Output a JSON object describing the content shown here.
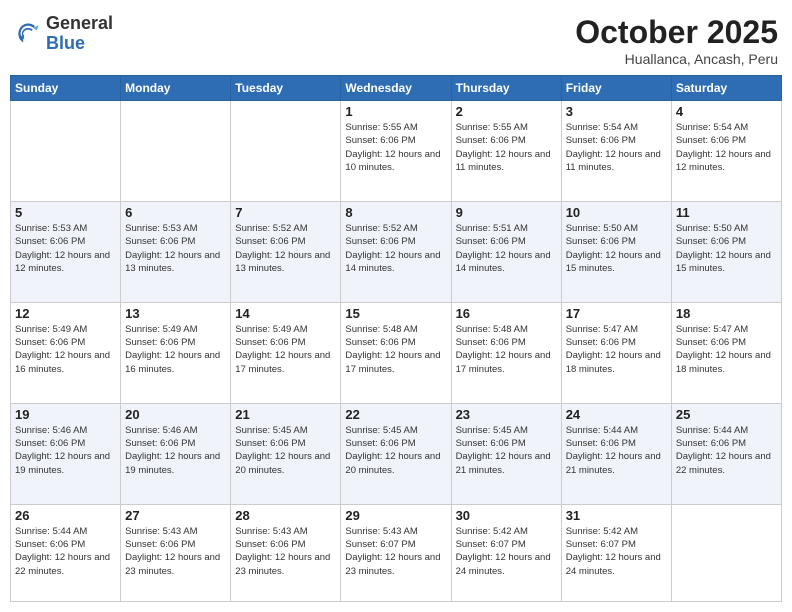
{
  "header": {
    "logo_general": "General",
    "logo_blue": "Blue",
    "month_title": "October 2025",
    "location": "Huallanca, Ancash, Peru"
  },
  "days_of_week": [
    "Sunday",
    "Monday",
    "Tuesday",
    "Wednesday",
    "Thursday",
    "Friday",
    "Saturday"
  ],
  "weeks": [
    [
      {
        "day": "",
        "info": ""
      },
      {
        "day": "",
        "info": ""
      },
      {
        "day": "",
        "info": ""
      },
      {
        "day": "1",
        "info": "Sunrise: 5:55 AM\nSunset: 6:06 PM\nDaylight: 12 hours\nand 10 minutes."
      },
      {
        "day": "2",
        "info": "Sunrise: 5:55 AM\nSunset: 6:06 PM\nDaylight: 12 hours\nand 11 minutes."
      },
      {
        "day": "3",
        "info": "Sunrise: 5:54 AM\nSunset: 6:06 PM\nDaylight: 12 hours\nand 11 minutes."
      },
      {
        "day": "4",
        "info": "Sunrise: 5:54 AM\nSunset: 6:06 PM\nDaylight: 12 hours\nand 12 minutes."
      }
    ],
    [
      {
        "day": "5",
        "info": "Sunrise: 5:53 AM\nSunset: 6:06 PM\nDaylight: 12 hours\nand 12 minutes."
      },
      {
        "day": "6",
        "info": "Sunrise: 5:53 AM\nSunset: 6:06 PM\nDaylight: 12 hours\nand 13 minutes."
      },
      {
        "day": "7",
        "info": "Sunrise: 5:52 AM\nSunset: 6:06 PM\nDaylight: 12 hours\nand 13 minutes."
      },
      {
        "day": "8",
        "info": "Sunrise: 5:52 AM\nSunset: 6:06 PM\nDaylight: 12 hours\nand 14 minutes."
      },
      {
        "day": "9",
        "info": "Sunrise: 5:51 AM\nSunset: 6:06 PM\nDaylight: 12 hours\nand 14 minutes."
      },
      {
        "day": "10",
        "info": "Sunrise: 5:50 AM\nSunset: 6:06 PM\nDaylight: 12 hours\nand 15 minutes."
      },
      {
        "day": "11",
        "info": "Sunrise: 5:50 AM\nSunset: 6:06 PM\nDaylight: 12 hours\nand 15 minutes."
      }
    ],
    [
      {
        "day": "12",
        "info": "Sunrise: 5:49 AM\nSunset: 6:06 PM\nDaylight: 12 hours\nand 16 minutes."
      },
      {
        "day": "13",
        "info": "Sunrise: 5:49 AM\nSunset: 6:06 PM\nDaylight: 12 hours\nand 16 minutes."
      },
      {
        "day": "14",
        "info": "Sunrise: 5:49 AM\nSunset: 6:06 PM\nDaylight: 12 hours\nand 17 minutes."
      },
      {
        "day": "15",
        "info": "Sunrise: 5:48 AM\nSunset: 6:06 PM\nDaylight: 12 hours\nand 17 minutes."
      },
      {
        "day": "16",
        "info": "Sunrise: 5:48 AM\nSunset: 6:06 PM\nDaylight: 12 hours\nand 17 minutes."
      },
      {
        "day": "17",
        "info": "Sunrise: 5:47 AM\nSunset: 6:06 PM\nDaylight: 12 hours\nand 18 minutes."
      },
      {
        "day": "18",
        "info": "Sunrise: 5:47 AM\nSunset: 6:06 PM\nDaylight: 12 hours\nand 18 minutes."
      }
    ],
    [
      {
        "day": "19",
        "info": "Sunrise: 5:46 AM\nSunset: 6:06 PM\nDaylight: 12 hours\nand 19 minutes."
      },
      {
        "day": "20",
        "info": "Sunrise: 5:46 AM\nSunset: 6:06 PM\nDaylight: 12 hours\nand 19 minutes."
      },
      {
        "day": "21",
        "info": "Sunrise: 5:45 AM\nSunset: 6:06 PM\nDaylight: 12 hours\nand 20 minutes."
      },
      {
        "day": "22",
        "info": "Sunrise: 5:45 AM\nSunset: 6:06 PM\nDaylight: 12 hours\nand 20 minutes."
      },
      {
        "day": "23",
        "info": "Sunrise: 5:45 AM\nSunset: 6:06 PM\nDaylight: 12 hours\nand 21 minutes."
      },
      {
        "day": "24",
        "info": "Sunrise: 5:44 AM\nSunset: 6:06 PM\nDaylight: 12 hours\nand 21 minutes."
      },
      {
        "day": "25",
        "info": "Sunrise: 5:44 AM\nSunset: 6:06 PM\nDaylight: 12 hours\nand 22 minutes."
      }
    ],
    [
      {
        "day": "26",
        "info": "Sunrise: 5:44 AM\nSunset: 6:06 PM\nDaylight: 12 hours\nand 22 minutes."
      },
      {
        "day": "27",
        "info": "Sunrise: 5:43 AM\nSunset: 6:06 PM\nDaylight: 12 hours\nand 23 minutes."
      },
      {
        "day": "28",
        "info": "Sunrise: 5:43 AM\nSunset: 6:06 PM\nDaylight: 12 hours\nand 23 minutes."
      },
      {
        "day": "29",
        "info": "Sunrise: 5:43 AM\nSunset: 6:07 PM\nDaylight: 12 hours\nand 23 minutes."
      },
      {
        "day": "30",
        "info": "Sunrise: 5:42 AM\nSunset: 6:07 PM\nDaylight: 12 hours\nand 24 minutes."
      },
      {
        "day": "31",
        "info": "Sunrise: 5:42 AM\nSunset: 6:07 PM\nDaylight: 12 hours\nand 24 minutes."
      },
      {
        "day": "",
        "info": ""
      }
    ]
  ]
}
